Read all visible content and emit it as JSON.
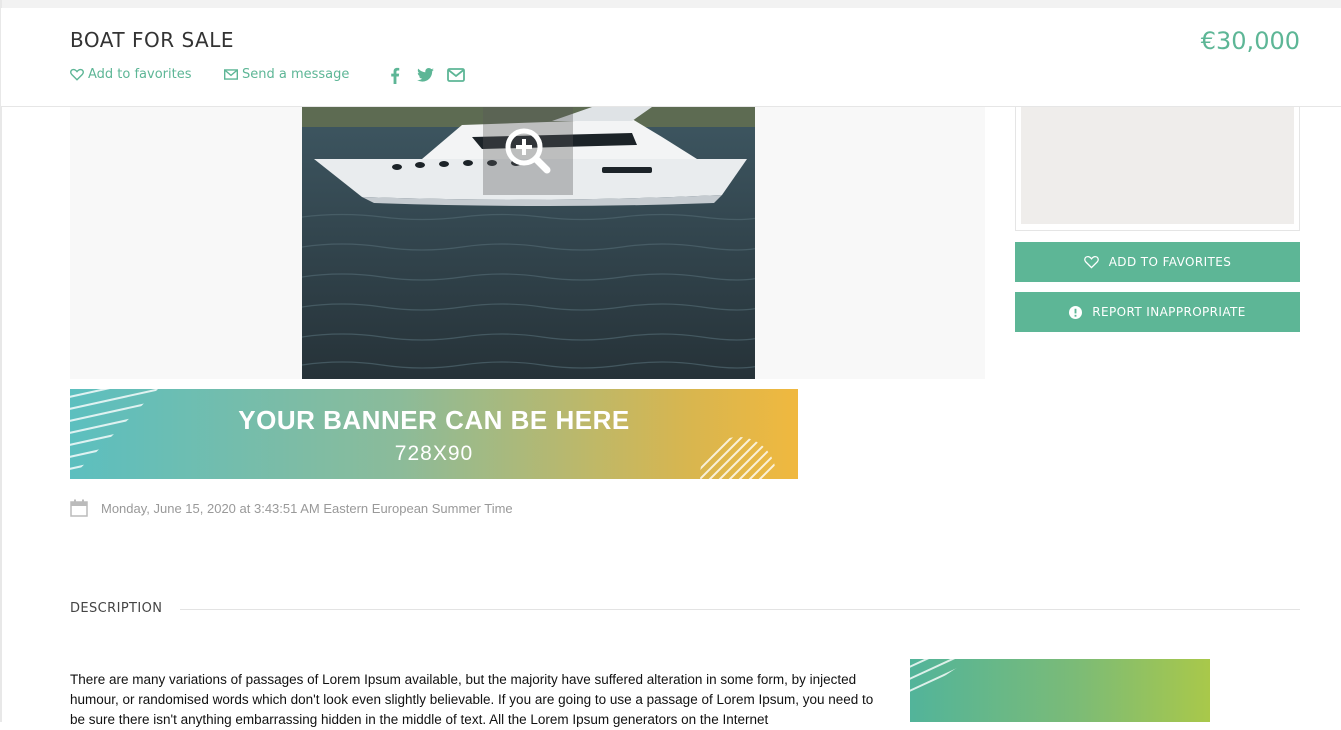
{
  "header": {
    "title": "BOAT FOR SALE",
    "price": "€30,000",
    "add_favorites_label": "Add to favorites",
    "send_message_label": "Send a message",
    "icons": [
      "heart-outline-icon",
      "envelope-outline-icon",
      "facebook-icon",
      "twitter-icon",
      "mail-icon"
    ]
  },
  "gallery": {
    "zoom_icon": "zoom-in-icon"
  },
  "sidebar": {
    "add_favorites_button": "ADD TO FAVORITES",
    "report_button": "REPORT INAPPROPRIATE"
  },
  "banner": {
    "title": "YOUR BANNER CAN BE HERE",
    "size": "728X90"
  },
  "listing": {
    "date": "Monday, June 15, 2020 at 3:43:51 AM Eastern European Summer Time"
  },
  "description": {
    "heading": "DESCRIPTION",
    "text": "There are many variations of passages of Lorem Ipsum available, but the majority have suffered alteration in some form, by injected humour, or randomised words which don't look even slightly believable. If you are going to use a passage of Lorem Ipsum, you need to be sure there isn't anything embarrassing hidden in the middle of text. All the Lorem Ipsum generators on the Internet"
  },
  "colors": {
    "accent": "#5db696",
    "map_background": "#efedeb",
    "muted_text": "#999999"
  }
}
